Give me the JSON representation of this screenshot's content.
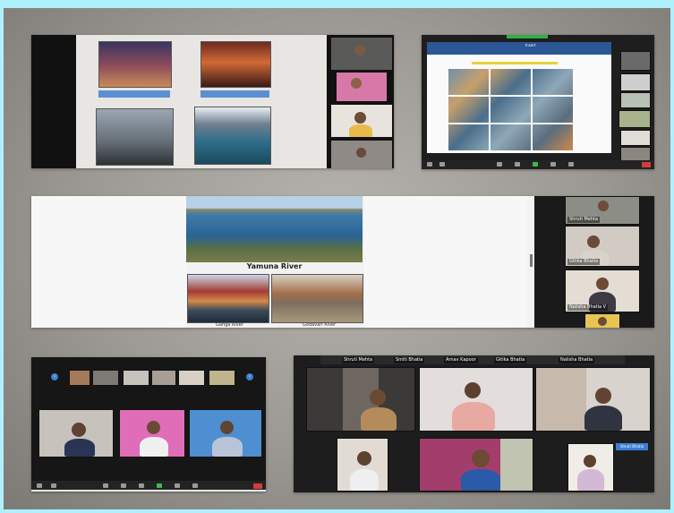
{
  "panels": {
    "top_right": {
      "toolbar_tab": "Insert"
    },
    "middle": {
      "slide_title": "Yamuna River",
      "caption_left": "Ganga River",
      "caption_right": "Godavari River",
      "participants": [
        {
          "name": "Shruti Mehta"
        },
        {
          "name": "Gitika Bhatia"
        },
        {
          "name": "Nalisha Bhatia V"
        },
        {
          "name": ""
        }
      ]
    },
    "bottom_left": {
      "nav_prev": "‹",
      "nav_next": "›"
    },
    "bottom_right": {
      "top_strip_names": [
        "Shruti Mehta",
        "Smiti Bhatia",
        "Arnav Kapoor",
        "Gitika Bhatia",
        "Nalisha Bhatia"
      ],
      "active_tag": "Shruti Bhatia"
    }
  },
  "colors": {
    "page_bg": "#aef0fb",
    "zoom_dark": "#1b1b1b",
    "end_button": "#d53c3c",
    "accent_blue": "#3c7fd4"
  }
}
